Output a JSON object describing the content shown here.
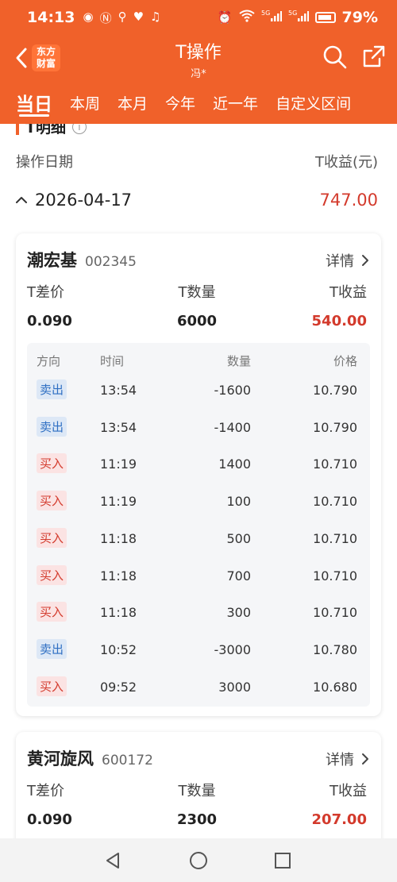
{
  "status": {
    "time": "14:13",
    "left_icons": [
      "eye-icon",
      "n-icon",
      "link-icon",
      "heart-icon",
      "music-icon"
    ],
    "right_icons": [
      "alarm-icon",
      "wifi-icon",
      "5g-signal-icon",
      "5g-signal-icon",
      "battery-icon"
    ],
    "battery": "79%"
  },
  "app": {
    "logo_line1": "东方",
    "logo_line2": "财富",
    "title": "T操作",
    "subtitle": "冯*"
  },
  "tabs": [
    "当日",
    "本周",
    "本月",
    "今年",
    "近一年",
    "自定义区间"
  ],
  "section": {
    "title": "T明细",
    "col_date": "操作日期",
    "col_profit": "T收益(元)"
  },
  "date_group": {
    "date": "2026-04-17",
    "total": "747.00"
  },
  "stocks": [
    {
      "name": "潮宏基",
      "code": "002345",
      "detail": "详情",
      "labels": [
        "T差价",
        "T数量",
        "T收益"
      ],
      "diff": "0.090",
      "qty": "6000",
      "profit": "540.00",
      "table_head": [
        "方向",
        "时间",
        "数量",
        "价格"
      ],
      "trades": [
        {
          "dir": "卖出",
          "type": "sell",
          "time": "13:54",
          "qty": "-1600",
          "price": "10.790"
        },
        {
          "dir": "卖出",
          "type": "sell",
          "time": "13:54",
          "qty": "-1400",
          "price": "10.790"
        },
        {
          "dir": "买入",
          "type": "buy",
          "time": "11:19",
          "qty": "1400",
          "price": "10.710"
        },
        {
          "dir": "买入",
          "type": "buy",
          "time": "11:19",
          "qty": "100",
          "price": "10.710"
        },
        {
          "dir": "买入",
          "type": "buy",
          "time": "11:18",
          "qty": "500",
          "price": "10.710"
        },
        {
          "dir": "买入",
          "type": "buy",
          "time": "11:18",
          "qty": "700",
          "price": "10.710"
        },
        {
          "dir": "买入",
          "type": "buy",
          "time": "11:18",
          "qty": "300",
          "price": "10.710"
        },
        {
          "dir": "卖出",
          "type": "sell",
          "time": "10:52",
          "qty": "-3000",
          "price": "10.780"
        },
        {
          "dir": "买入",
          "type": "buy",
          "time": "09:52",
          "qty": "3000",
          "price": "10.680"
        }
      ]
    },
    {
      "name": "黄河旋风",
      "code": "600172",
      "detail": "详情",
      "labels": [
        "T差价",
        "T数量",
        "T收益"
      ],
      "diff": "0.090",
      "qty": "2300",
      "profit": "207.00"
    }
  ],
  "colors": {
    "brand": "#f0612a",
    "profit_red": "#d33a2c",
    "sell_blue": "#2f6fc3"
  }
}
